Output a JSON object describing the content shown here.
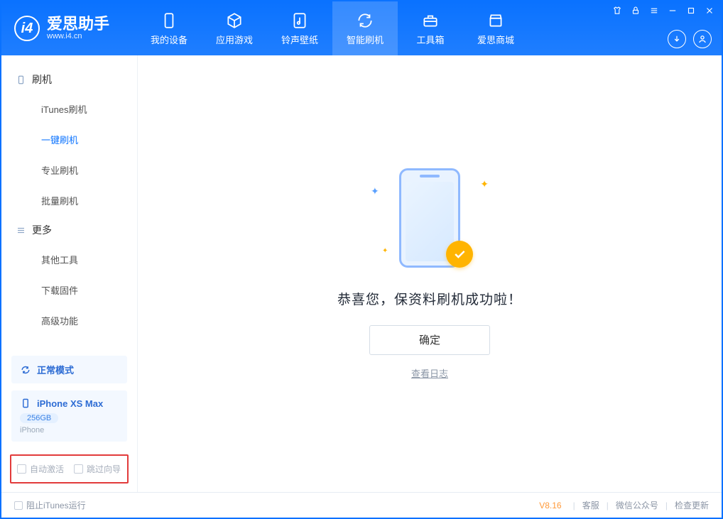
{
  "brand": {
    "name": "爱思助手",
    "url": "www.i4.cn",
    "logo_letter": "i4"
  },
  "header": {
    "tabs": [
      {
        "label": "我的设备"
      },
      {
        "label": "应用游戏"
      },
      {
        "label": "铃声壁纸"
      },
      {
        "label": "智能刷机",
        "active": true
      },
      {
        "label": "工具箱"
      },
      {
        "label": "爱思商城"
      }
    ]
  },
  "sidebar": {
    "groups": [
      {
        "title": "刷机",
        "icon": "phone-icon",
        "items": [
          {
            "label": "iTunes刷机"
          },
          {
            "label": "一键刷机",
            "active": true
          },
          {
            "label": "专业刷机"
          },
          {
            "label": "批量刷机"
          }
        ]
      },
      {
        "title": "更多",
        "icon": "menu-icon",
        "items": [
          {
            "label": "其他工具"
          },
          {
            "label": "下载固件"
          },
          {
            "label": "高级功能"
          }
        ]
      }
    ],
    "mode_card": {
      "label": "正常模式"
    },
    "device_card": {
      "name": "iPhone XS Max",
      "capacity": "256GB",
      "type": "iPhone"
    },
    "options": {
      "auto_activate": "自动激活",
      "skip_guide": "跳过向导"
    }
  },
  "main": {
    "success_text": "恭喜您，保资料刷机成功啦！",
    "ok_label": "确定",
    "log_link": "查看日志"
  },
  "footer": {
    "block_itunes": "阻止iTunes运行",
    "version": "V8.16",
    "links": {
      "support": "客服",
      "wechat": "微信公众号",
      "update": "检查更新"
    }
  }
}
